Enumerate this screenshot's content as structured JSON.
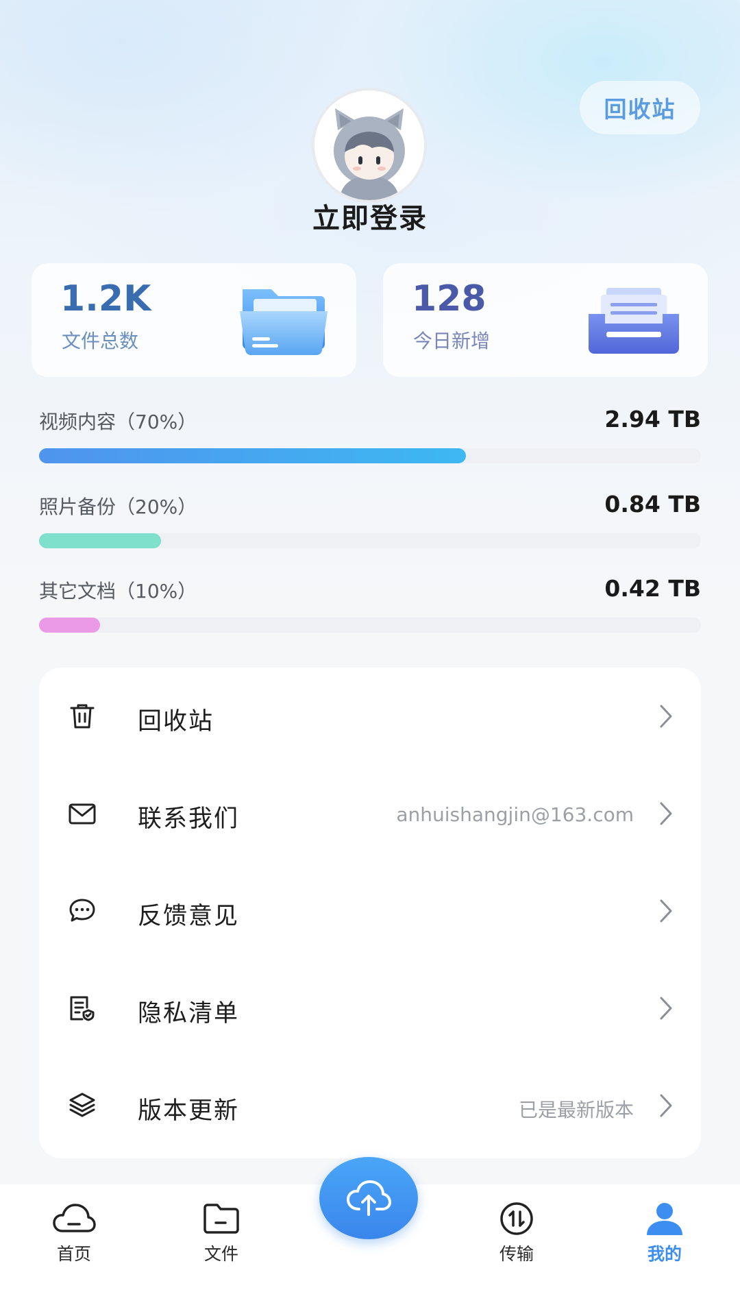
{
  "header": {
    "recycle_label": "回收站",
    "login_label": "立即登录"
  },
  "stats": [
    {
      "value": "1.2K",
      "label": "文件总数",
      "icon": "folder-open-icon"
    },
    {
      "value": "128",
      "label": "今日新增",
      "icon": "document-tray-icon"
    }
  ],
  "storage": [
    {
      "label": "视频内容（70%）",
      "size": "2.94 TB",
      "percent": 70,
      "color": "#4a9cf0"
    },
    {
      "label": "照片备份（20%）",
      "size": "0.84 TB",
      "percent": 20,
      "color": "#7fe0cc"
    },
    {
      "label": "其它文档（10%）",
      "size": "0.42 TB",
      "percent": 10,
      "color": "#ea9ae6"
    }
  ],
  "menu": [
    {
      "label": "回收站",
      "extra": "",
      "icon": "trash-icon"
    },
    {
      "label": "联系我们",
      "extra": "anhuishangjin@163.com",
      "icon": "mail-icon"
    },
    {
      "label": "反馈意见",
      "extra": "",
      "icon": "chat-bubble-icon"
    },
    {
      "label": "隐私清单",
      "extra": "",
      "icon": "privacy-list-icon"
    },
    {
      "label": "版本更新",
      "extra": "已是最新版本",
      "icon": "layers-icon"
    }
  ],
  "tabbar": {
    "tabs": [
      {
        "label": "首页",
        "icon": "cloud-icon",
        "active": false
      },
      {
        "label": "文件",
        "icon": "folder-icon",
        "active": false
      },
      {
        "label": "传输",
        "icon": "transfer-icon",
        "active": false
      },
      {
        "label": "我的",
        "icon": "user-icon",
        "active": true
      }
    ],
    "upload_icon": "cloud-upload-icon"
  },
  "colors": {
    "accent": "#3c8ff0",
    "stat_value_1": "#3a6db0",
    "stat_value_2": "#4a5aa8"
  }
}
